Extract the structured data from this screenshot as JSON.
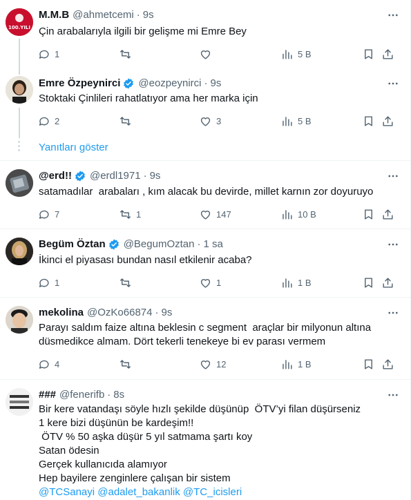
{
  "colors": {
    "accent": "#1d9bf0",
    "muted": "#536471",
    "text": "#0f1419",
    "verified": "#1d9bf0"
  },
  "show_replies": "Yanıtları göster",
  "tweets": [
    {
      "name": "M.M.B",
      "handle": "@ahmetcemi",
      "time": "9s",
      "verified": false,
      "text": [
        "Çin arabalarıyla ilgili bir gelişme mi Emre Bey"
      ],
      "replies": "1",
      "retweets": "",
      "likes": "",
      "views": "5 B",
      "avatar_text": "100.YILI"
    },
    {
      "name": "Emre Özpeynirci",
      "handle": "@eozpeynirci",
      "time": "9s",
      "verified": true,
      "text": [
        "Stoktaki Çinlileri rahatlatıyor ama her marka için"
      ],
      "replies": "2",
      "retweets": "",
      "likes": "3",
      "views": "5 B"
    },
    {
      "name": "@erd!!",
      "handle": "@erdl1971",
      "time": "9s",
      "verified": true,
      "text": [
        "satamadılar  arabaları , kım alacak bu devirde, millet karnın zor doyuruyo"
      ],
      "replies": "7",
      "retweets": "1",
      "likes": "147",
      "views": "10 B"
    },
    {
      "name": "Begüm Öztan",
      "handle": "@BegumOztan",
      "time": "1 sa",
      "verified": true,
      "text": [
        "İkinci el piyasası bundan nasıl etkilenir acaba?"
      ],
      "replies": "1",
      "retweets": "",
      "likes": "1",
      "views": "1 B"
    },
    {
      "name": "mekolina",
      "handle": "@OzKo66874",
      "time": "9s",
      "verified": false,
      "text": [
        "Parayı saldım faize altına beklesin c segment  araçlar bir milyonun altına",
        "düsmedikce almam. Dört tekerli tenekeye bi ev parası vermem"
      ],
      "replies": "4",
      "retweets": "",
      "likes": "12",
      "views": "1 B"
    },
    {
      "name": "###",
      "handle": "@fenerifb",
      "time": "8s",
      "verified": false,
      "text": [
        "Bir kere vatandaşı söyle hızlı şekilde düşünüp  ÖTV’yi filan düşürseniz",
        "1 kere bizi düşünün be kardeşim!!",
        " ÖTV % 50 aşka düşür 5 yıl satmama şartı koy",
        "Satan ödesin",
        "Gerçek kullanıcıda alamıyor",
        "Hep bayilere zenginlere çalışan bir sistem"
      ],
      "mentions": [
        "@TCSanayi",
        "@adalet_bakanlik",
        "@TC_icisleri"
      ]
    }
  ]
}
